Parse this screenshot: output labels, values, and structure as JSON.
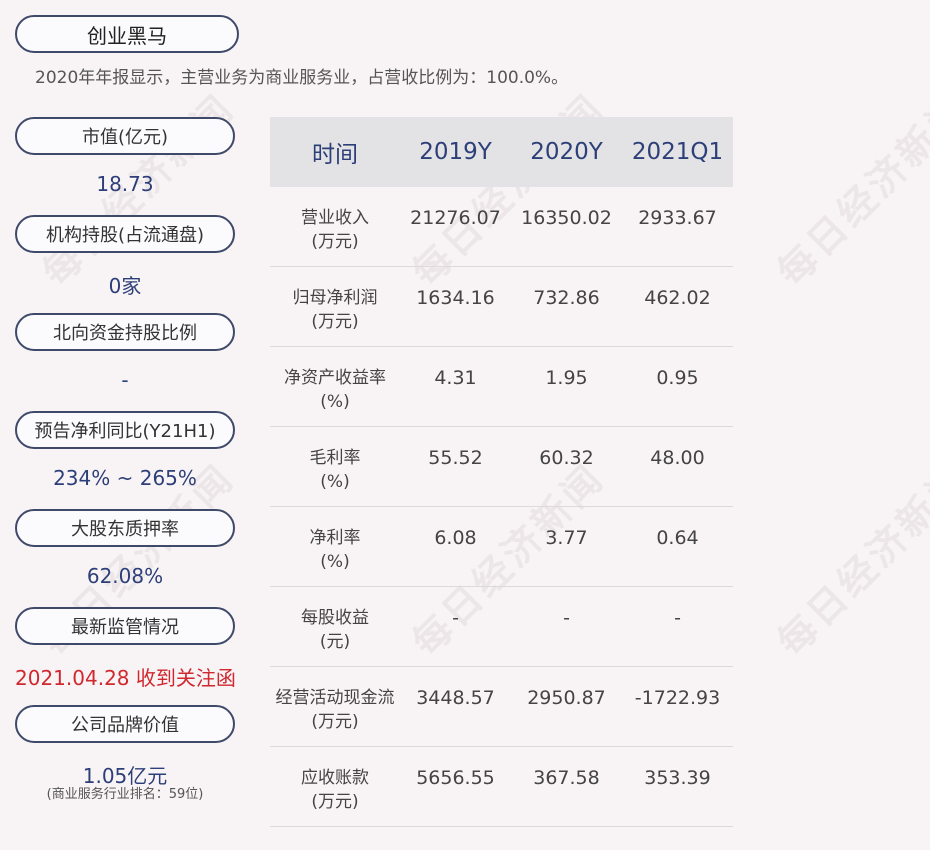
{
  "header": {
    "title": "创业黑马",
    "subtitle": "2020年年报显示，主营业务为商业服务业，占营收比例为：100.0%。"
  },
  "metrics": [
    {
      "label": "市值(亿元)",
      "value": "18.73"
    },
    {
      "label": "机构持股(占流通盘)",
      "value": "0家"
    },
    {
      "label": "北向资金持股比例",
      "value": "-"
    },
    {
      "label": "预告净利同比(Y21H1)",
      "value": "234% ~ 265%"
    },
    {
      "label": "大股东质押率",
      "value": "62.08%"
    },
    {
      "label": "最新监管情况",
      "value": "2021.04.28 收到关注函"
    },
    {
      "label": "公司品牌价值",
      "value": "1.05亿元",
      "note": "(商业服务行业排名：59位)"
    }
  ],
  "table": {
    "headers": [
      "时间",
      "2019Y",
      "2020Y",
      "2021Q1"
    ],
    "rows": [
      {
        "name": "营业收入",
        "unit": "(万元)",
        "values": [
          "21276.07",
          "16350.02",
          "2933.67"
        ]
      },
      {
        "name": "归母净利润",
        "unit": "(万元)",
        "values": [
          "1634.16",
          "732.86",
          "462.02"
        ]
      },
      {
        "name": "净资产收益率",
        "unit": "(%)",
        "values": [
          "4.31",
          "1.95",
          "0.95"
        ]
      },
      {
        "name": "毛利率",
        "unit": "(%)",
        "values": [
          "55.52",
          "60.32",
          "48.00"
        ]
      },
      {
        "name": "净利率",
        "unit": "(%)",
        "values": [
          "6.08",
          "3.77",
          "0.64"
        ]
      },
      {
        "name": "每股收益",
        "unit": "(元)",
        "values": [
          "-",
          "-",
          "-"
        ]
      },
      {
        "name": "经营活动现金流",
        "unit": "(万元)",
        "values": [
          "3448.57",
          "2950.87",
          "-1722.93"
        ]
      },
      {
        "name": "应收账款",
        "unit": "(万元)",
        "values": [
          "5656.55",
          "367.58",
          "353.39"
        ]
      }
    ]
  },
  "watermark": "每日经济新闻",
  "colors": {
    "background": "#f8f3f5",
    "accent_blue": "#2d3f78",
    "alert_red": "#d0282f",
    "pill_border": "#3f4a6a",
    "table_header_bg": "#e3e3e5"
  }
}
